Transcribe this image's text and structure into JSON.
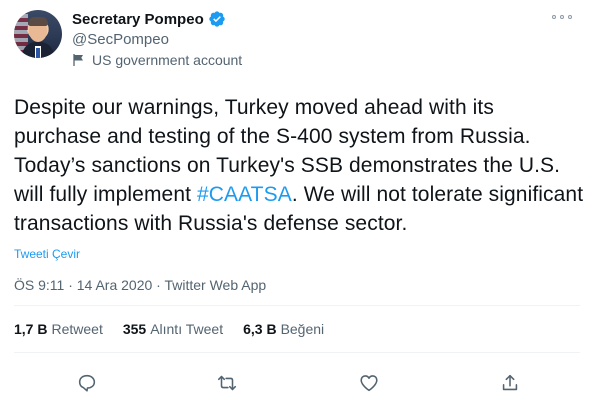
{
  "author": {
    "display_name": "Secretary Pompeo",
    "handle": "@SecPompeo",
    "label": "US government account"
  },
  "tweet": {
    "text_before": "Despite our warnings, Turkey moved ahead with its purchase and testing of the S-400 system from Russia. Today’s sanctions on Turkey's SSB demonstrates the U.S. will fully implement ",
    "hashtag": "#CAATSA",
    "text_after": ". We will not tolerate significant transactions with Russia's defense sector.",
    "translate_label": "Tweeti Çevir",
    "meta": "ÖS 9:11 · 14 Ara 2020 · Twitter Web App"
  },
  "stats": {
    "retweets_count": "1,7 B",
    "retweets_label": "Retweet",
    "quotes_count": "355",
    "quotes_label": "Alıntı Tweet",
    "likes_count": "6,3 B",
    "likes_label": "Beğeni"
  },
  "colors": {
    "accent": "#1d9bf0",
    "text": "#0f1419",
    "secondary": "#536471"
  },
  "icons": {
    "verified": "verified-badge-icon",
    "gov": "flag-icon",
    "more": "more-options-icon",
    "reply": "reply-icon",
    "retweet": "retweet-icon",
    "like": "heart-icon",
    "share": "share-icon"
  }
}
